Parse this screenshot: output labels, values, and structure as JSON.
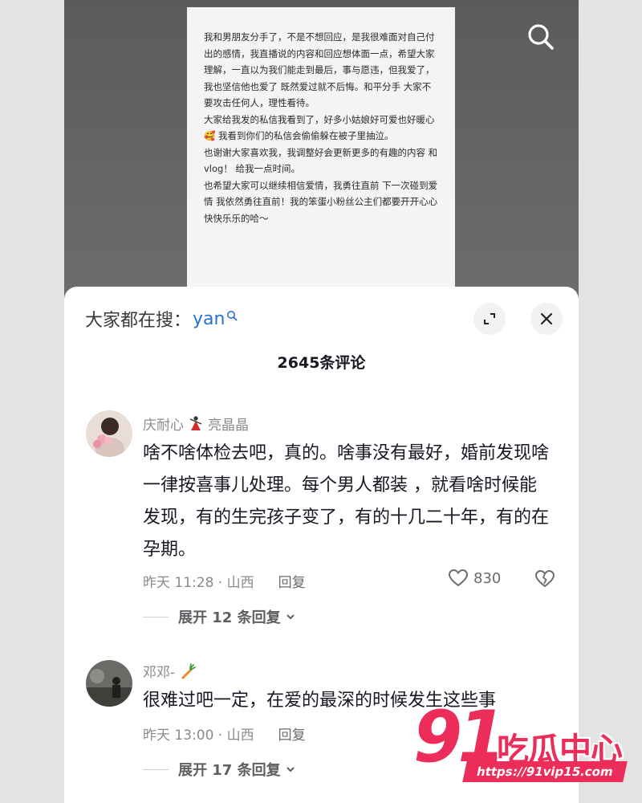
{
  "note": {
    "paragraphs": [
      "我和男朋友分手了，不是不想回应，是我很难面对自己付出的感情，我直播说的内容和回应想体面一点，希望大家理解，一直以为我们能走到最后，事与愿违，但我爱了，我也坚信他也爱了 既然爱过就不后悔。和平分手 大家不要攻击任何人，理性看待。",
      "大家给我发的私信我看到了，好多小姑娘好可爱也好暖心 🥰 我看到你们的私信会偷偷躲在被子里抽泣。",
      "也谢谢大家喜欢我，我调整好会更新更多的有趣的内容 和vlog！ 给我一点时间。",
      "也希望大家可以继续相信爱情，我勇往直前 下一次碰到爱情 我依然勇往直前！我的笨蛋小粉丝公主们都要开开心心快快乐乐的哈～"
    ]
  },
  "sheet": {
    "search_prefix": "大家都在搜：",
    "search_keyword": "yan",
    "comment_count": "2645条评论"
  },
  "comments": [
    {
      "username": "庆耐心",
      "username_suffix": "亮晶晶",
      "text": "啥不啥体检去吧，真的。啥事没有最好，婚前发现啥一律按喜事儿处理。每个男人都装 ，就看啥时候能发现，有的生完孩子变了，有的十几二十年，有的在孕期。",
      "time_location": "昨天 11:28 · 山西",
      "reply_label": "回复",
      "likes": "830",
      "expand_label": "展开 12 条回复"
    },
    {
      "username": "邓邓-",
      "text": "很难过吧一定，在爱的最深的时候发生这些事",
      "time_location": "昨天 13:00 · 山西",
      "reply_label": "回复",
      "expand_label": "展开 17 条回复"
    }
  ],
  "watermark": {
    "number": "91",
    "name": "吃瓜中心",
    "url": "https://91vip15.com"
  },
  "colors": {
    "accent_link": "#2a6fd1",
    "watermark": "#ec2d5a"
  }
}
